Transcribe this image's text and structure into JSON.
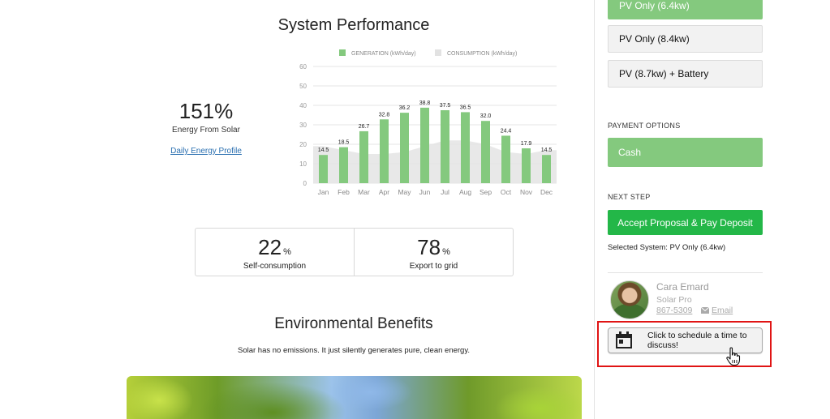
{
  "performance": {
    "title": "System Performance",
    "energy_pct": "151%",
    "energy_label": "Energy From Solar",
    "profile_link": "Daily Energy Profile"
  },
  "chart_data": {
    "type": "bar",
    "legend": [
      "GENERATION (kWh/day)",
      "CONSUMPTION (kWh/day)"
    ],
    "categories": [
      "Jan",
      "Feb",
      "Mar",
      "Apr",
      "May",
      "Jun",
      "Jul",
      "Aug",
      "Sep",
      "Oct",
      "Nov",
      "Dec"
    ],
    "series": [
      {
        "name": "GENERATION (kWh/day)",
        "values": [
          14.5,
          18.5,
          26.7,
          32.8,
          36.2,
          38.8,
          37.5,
          36.5,
          32.0,
          24.4,
          17.9,
          14.5
        ],
        "labels": [
          "14.5",
          "18.5",
          "26.7",
          "32.8",
          "36.2",
          "38.8",
          "37.5",
          "36.5",
          "32.0",
          "24.4",
          "17.9",
          "14.5"
        ]
      },
      {
        "name": "CONSUMPTION (kWh/day)",
        "values": [
          19,
          17,
          15,
          15,
          16,
          19,
          22,
          22,
          20,
          16,
          15,
          17
        ]
      }
    ],
    "yticks": [
      "60",
      "50",
      "40",
      "30",
      "20",
      "10",
      "0"
    ],
    "ylim": [
      0,
      60
    ],
    "grid": true,
    "legend_position": "top",
    "colors": {
      "generation": "#84c97e",
      "consumption": "#e2e2e2"
    }
  },
  "split": {
    "self_value": "22",
    "self_unit": "%",
    "self_label": "Self-consumption",
    "export_value": "78",
    "export_unit": "%",
    "export_label": "Export to grid"
  },
  "environment": {
    "title": "Environmental Benefits",
    "subtitle": "Solar has no emissions. It just silently generates pure, clean energy."
  },
  "sidebar": {
    "systems": [
      {
        "label": "PV Only (6.4kw)",
        "active": true
      },
      {
        "label": "PV Only (8.4kw)",
        "active": false
      },
      {
        "label": "PV (8.7kw) + Battery",
        "active": false
      }
    ],
    "payment_label": "PAYMENT OPTIONS",
    "payment_option": "Cash",
    "next_step_label": "NEXT STEP",
    "accept_label": "Accept Proposal & Pay Deposit",
    "selected_system": "Selected System: PV Only (6.4kw)",
    "rep": {
      "name": "Cara Emard",
      "role": "Solar Pro",
      "phone": "867-5309",
      "email_label": "Email"
    },
    "schedule_label": "Click to schedule a time to discuss!"
  },
  "colors": {
    "accent_green": "#84c97e",
    "cta_green": "#23b748",
    "highlight_red": "#e01414"
  }
}
